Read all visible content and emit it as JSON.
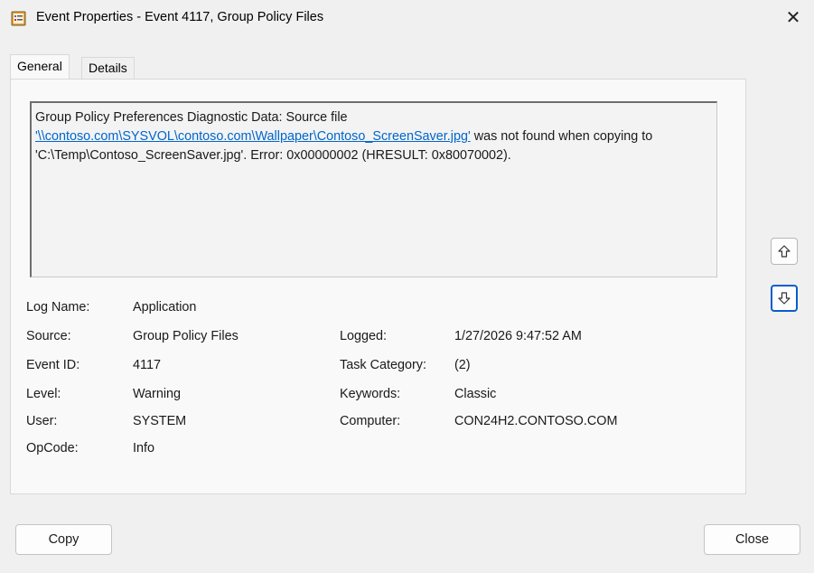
{
  "window": {
    "title": "Event Properties - Event 4117, Group Policy Files",
    "close_glyph": "✕"
  },
  "tabs": [
    {
      "label": "General",
      "selected": true
    },
    {
      "label": "Details",
      "selected": false
    }
  ],
  "description": {
    "prefix": "Group Policy Preferences Diagnostic Data: Source file ",
    "link": "'\\\\contoso.com\\SYSVOL\\contoso.com\\Wallpaper\\Contoso_ScreenSaver.jpg'",
    "suffix": " was not found when copying to 'C:\\Temp\\Contoso_ScreenSaver.jpg'. Error: 0x00000002 (HRESULT: 0x80070002)."
  },
  "fields": {
    "log_name": {
      "label": "Log Name:",
      "value": "Application"
    },
    "source": {
      "label": "Source:",
      "value": "Group Policy Files"
    },
    "event_id": {
      "label": "Event ID:",
      "value": "4117"
    },
    "level": {
      "label": "Level:",
      "value": "Warning"
    },
    "user": {
      "label": "User:",
      "value": "SYSTEM"
    },
    "opcode": {
      "label": "OpCode:",
      "value": "Info"
    },
    "logged": {
      "label": "Logged:",
      "value": "1/27/2026 9:47:52 AM"
    },
    "task_category": {
      "label": "Task Category:",
      "value": "(2)"
    },
    "keywords": {
      "label": "Keywords:",
      "value": "Classic"
    },
    "computer": {
      "label": "Computer:",
      "value": "CON24H2.CONTOSO.COM"
    }
  },
  "buttons": {
    "copy": "Copy",
    "close": "Close"
  },
  "icons": {
    "app": "event-properties-icon",
    "up": "arrow-up-icon",
    "down": "arrow-down-icon"
  },
  "colors": {
    "link": "#0066cc",
    "focus": "#0a5ccc"
  }
}
